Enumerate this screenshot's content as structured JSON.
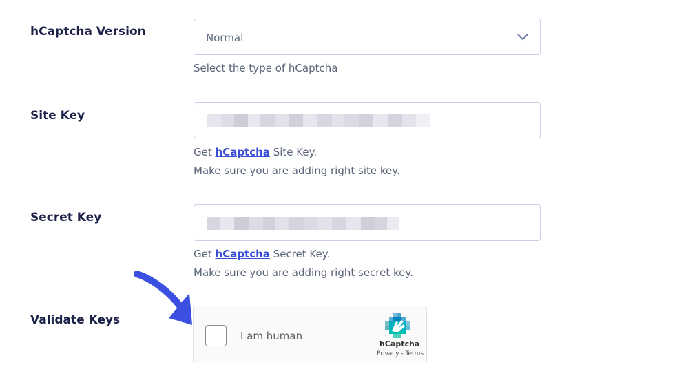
{
  "version": {
    "label": "hCaptcha Version",
    "selected": "Normal",
    "help": "Select the type of hCaptcha"
  },
  "site_key": {
    "label": "Site Key",
    "help_prefix": "Get ",
    "help_link": "hCaptcha",
    "help_suffix": " Site Key.",
    "help_line2": "Make sure you are adding right site key."
  },
  "secret_key": {
    "label": "Secret Key",
    "help_prefix": "Get ",
    "help_link": "hCaptcha",
    "help_suffix": " Secret Key.",
    "help_line2": "Make sure you are adding right secret key."
  },
  "validate": {
    "label": "Validate Keys"
  },
  "captcha_widget": {
    "checkbox_label": "I am human",
    "brand": "hCaptcha",
    "links": "Privacy - Terms"
  },
  "colors": {
    "label_text": "#1d2147",
    "link": "#3a4fd6",
    "arrow": "#3b50e0",
    "border": "#c8d0e8"
  },
  "icons": {
    "select_chevron": "chevron-down-icon",
    "annotation": "arrow-icon",
    "captcha_brand": "hcaptcha-logo-icon"
  }
}
